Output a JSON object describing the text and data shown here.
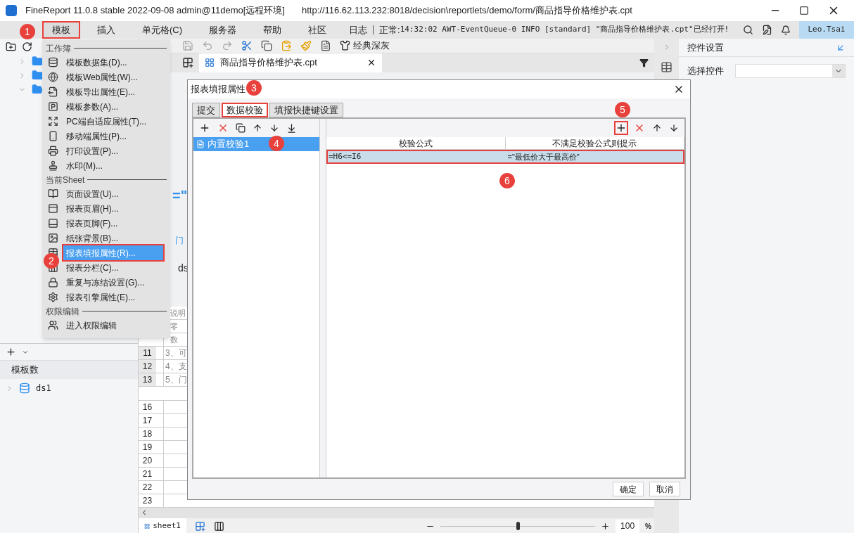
{
  "window": {
    "title": "FineReport 11.0.8 stable 2022-09-08 admin@11demo[远程环境]",
    "url": "http://116.62.113.232:8018/decision\\reportlets/demo/form/商品指导价格维护表.cpt"
  },
  "menubar": {
    "items": [
      {
        "label": "模板",
        "selected": true
      },
      {
        "label": "插入",
        "selected": false
      },
      {
        "label": "单元格(C)",
        "selected": false
      },
      {
        "label": "服务器",
        "selected": false
      },
      {
        "label": "帮助",
        "selected": false
      },
      {
        "label": "社区",
        "selected": false
      }
    ],
    "log": "日志",
    "status_label": "正常:",
    "status": "14:32:02 AWT-EventQueue-0 INFO [standard] \"商品指导价格维护表.cpt\"已经打开!",
    "user": "Leo.Tsai"
  },
  "toolbar": {
    "theme": "经典深灰"
  },
  "file_tab": "商品指导价格维护表.cpt",
  "left_panel": {
    "tab": "模板数",
    "dataset": "ds1"
  },
  "sheet": {
    "fragments": [
      "=\"",
      "门",
      "ds"
    ],
    "rows": [
      {
        "number": "",
        "text": "说明"
      },
      {
        "number": "",
        "text": "零"
      },
      {
        "number": "",
        "text": "数"
      },
      {
        "number": "11",
        "text": "3、可"
      },
      {
        "number": "12",
        "text": "4、支"
      },
      {
        "number": "13",
        "text": "5、门"
      }
    ],
    "empty_rows": [
      "16",
      "17",
      "18",
      "19",
      "20",
      "21",
      "22",
      "23"
    ],
    "tab": "sheet1",
    "zoom": "100",
    "zoom_unit": "%",
    "zoom_slider": {
      "level": 0.5
    }
  },
  "right_panel": {
    "title": "控件设置",
    "label": "选择控件"
  },
  "menu": {
    "sections": [
      {
        "title": "工作簿",
        "items": [
          {
            "label": "模板数据集(D)...",
            "selected": false
          },
          {
            "label": "模板Web属性(W)...",
            "selected": false
          },
          {
            "label": "模板导出属性(E)...",
            "selected": false
          },
          {
            "label": "模板参数(A)...",
            "selected": false
          },
          {
            "label": "PC端自适应属性(T)...",
            "selected": false
          },
          {
            "label": "移动端属性(P)...",
            "selected": false
          },
          {
            "label": "打印设置(P)...",
            "selected": false
          },
          {
            "label": "水印(M)...",
            "selected": false
          }
        ]
      },
      {
        "title": "当前Sheet",
        "items": [
          {
            "label": "页面设置(U)...",
            "selected": false
          },
          {
            "label": "报表页眉(H)...",
            "selected": false
          },
          {
            "label": "报表页脚(F)...",
            "selected": false
          },
          {
            "label": "纸张背景(B)...",
            "selected": false
          },
          {
            "label": "报表填报属性(R)...",
            "selected": true
          },
          {
            "label": "报表分栏(C)...",
            "selected": false
          },
          {
            "label": "重复与冻结设置(G)...",
            "selected": false
          },
          {
            "label": "报表引擎属性(E)...",
            "selected": false
          }
        ]
      },
      {
        "title": "权限编辑",
        "items": [
          {
            "label": "进入权限编辑",
            "selected": false
          }
        ]
      }
    ]
  },
  "dialog": {
    "title": "报表填报属性",
    "tabs": [
      {
        "label": "提交",
        "selected": false
      },
      {
        "label": "数据校验",
        "selected": true
      },
      {
        "label": "填报快捷键设置",
        "selected": false
      }
    ],
    "list": [
      {
        "label": "内置校验1",
        "selected": true
      }
    ],
    "columns": [
      "校验公式",
      "不满足校验公式则提示"
    ],
    "rows": [
      {
        "formula": "=H6<=I6",
        "message": "=\"最低价大于最高价\"",
        "selected": true
      }
    ],
    "buttons": [
      "确定",
      "取消"
    ]
  },
  "callouts": [
    "1",
    "2",
    "3",
    "4",
    "5",
    "6"
  ]
}
